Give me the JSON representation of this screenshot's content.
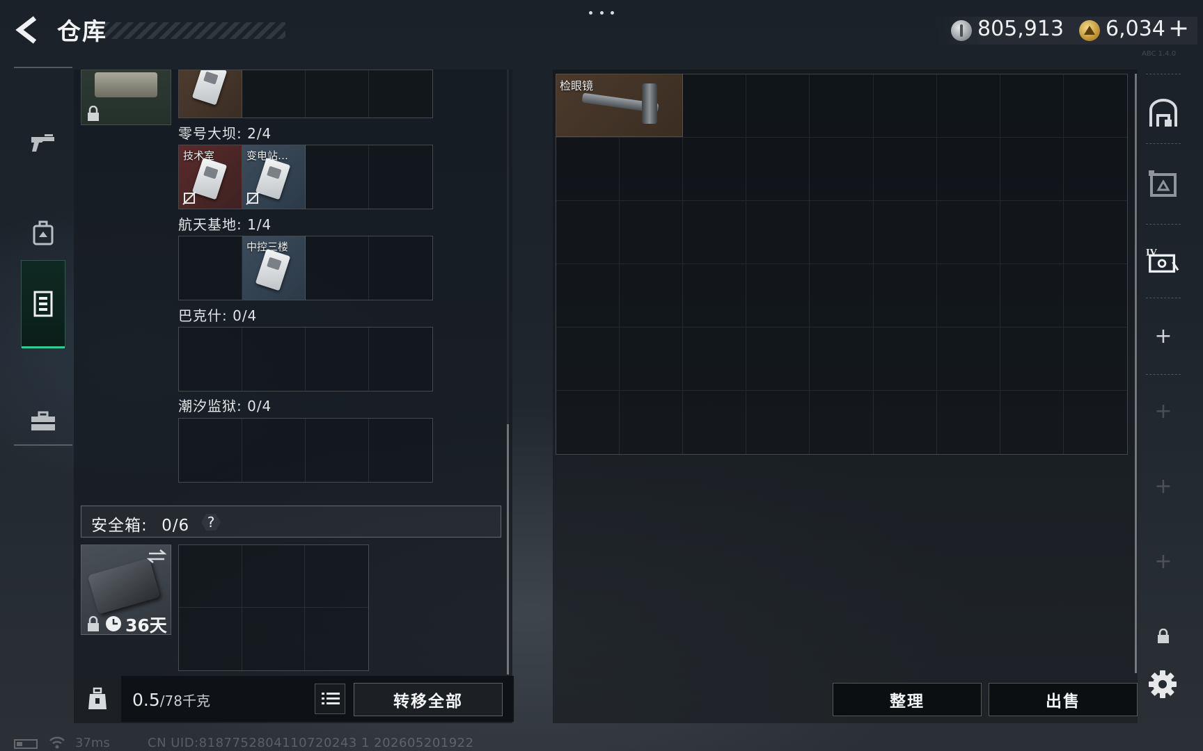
{
  "header": {
    "title": "仓库",
    "currency_silver": "805,913",
    "currency_gold": "6,034",
    "add_symbol": "+",
    "tiny_text": "ABC 1.4.0"
  },
  "left_rail": {
    "items": [
      {
        "id": "weapons",
        "icon": "pistol-icon",
        "active": false
      },
      {
        "id": "backpack",
        "icon": "backpack-icon",
        "active": false
      },
      {
        "id": "container",
        "icon": "container-icon",
        "active": true
      },
      {
        "id": "toolbox",
        "icon": "toolbox-icon",
        "active": false
      }
    ]
  },
  "keycard_sections": [
    {
      "label": "零号大坝: 2/4",
      "slots": []
    },
    {
      "label": "航天基地: 1/4",
      "slots": [
        {
          "label": "技术室",
          "color": "red"
        },
        {
          "label": "变电站…",
          "color": "blue"
        }
      ]
    },
    {
      "label": "巴克什: 0/4",
      "slots": [
        {
          "label": "中控三楼",
          "color": "blue"
        }
      ]
    },
    {
      "label": "潮汐监狱: 0/4",
      "slots": []
    }
  ],
  "safe_box": {
    "label": "安全箱:",
    "count": "0/6",
    "help": "?",
    "timer": "36天"
  },
  "left_footer": {
    "weight_value": "0.5",
    "weight_unit": "/78千克",
    "transfer_all": "转移全部"
  },
  "stash": {
    "items": [
      {
        "label": "检眼镜"
      }
    ]
  },
  "actions": {
    "organize": "整理",
    "sell": "出售"
  },
  "status_bar": {
    "ping": "37ms",
    "uid": "CN UID:8187752804110720243 1 202605201922"
  },
  "colors": {
    "accent_green": "#38c990",
    "keycard_red": "#5a2a2a",
    "keycard_blue": "#3c4c5c",
    "item_brown": "#4b3a2c"
  }
}
